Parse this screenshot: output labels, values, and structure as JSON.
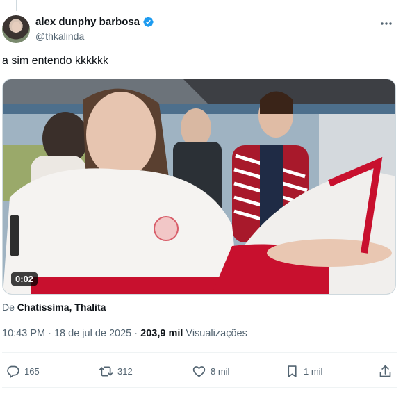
{
  "author": {
    "display_name": "alex dunphy barbosa",
    "handle": "@thkalinda",
    "verified_icon": "verified-badge-icon",
    "verified_color": "#1d9bf0"
  },
  "tweet": {
    "text": "a sim entendo kkkkkk",
    "video_timestamp": "0:02",
    "source_prefix": "De ",
    "source_name": "Chatissíma, Thalita",
    "time": "10:43 PM",
    "date": "18 de jul de 2025",
    "views_count": "203,9 mil",
    "views_label": "Visualizações"
  },
  "actions": {
    "replies": "165",
    "reposts": "312",
    "likes": "8 mil",
    "bookmarks": "1 mil"
  },
  "colors": {
    "text_primary": "#0f1419",
    "text_secondary": "#536471",
    "divider": "#eff3f4"
  }
}
